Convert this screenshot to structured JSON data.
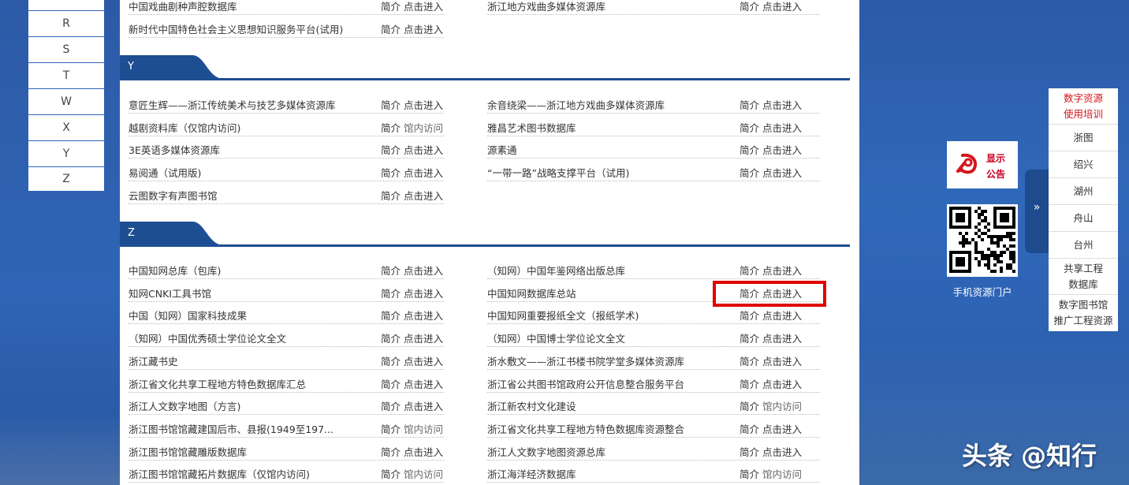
{
  "alphabet": {
    "partial": "",
    "letters": [
      "R",
      "S",
      "T",
      "W",
      "X",
      "Y",
      "Z"
    ]
  },
  "top_rows": [
    {
      "left": "中国戏曲剧种声腔数据库",
      "left_intro": "简介",
      "left_action": "点击进入",
      "right": "浙江地方戏曲多媒体资源库",
      "right_intro": "简介",
      "right_action": "点击进入"
    },
    {
      "left": "新时代中国特色社会主义思想知识服务平台(试用)",
      "left_intro": "简介",
      "left_action": "点击进入",
      "right": "",
      "right_intro": "",
      "right_action": ""
    }
  ],
  "section_y": {
    "label": "Y",
    "rows": [
      {
        "left": "意匠生辉——浙江传统美术与技艺多媒体资源库",
        "left_intro": "简介",
        "left_action": "点击进入",
        "right": "余音绕梁——浙江地方戏曲多媒体资源库",
        "right_intro": "简介",
        "right_action": "点击进入"
      },
      {
        "left": "越剧资料库（仅馆内访问)",
        "left_intro": "简介",
        "left_action": "馆内访问",
        "right": "雅昌艺术图书数据库",
        "right_intro": "简介",
        "right_action": "点击进入"
      },
      {
        "left": "3E英语多媒体资源库",
        "left_intro": "简介",
        "left_action": "点击进入",
        "right": "源素通",
        "right_intro": "简介",
        "right_action": "点击进入"
      },
      {
        "left": "易阅通（试用版)",
        "left_intro": "简介",
        "left_action": "点击进入",
        "right": "“一带一路”战略支撑平台（试用)",
        "right_intro": "简介",
        "right_action": "点击进入"
      },
      {
        "left": "云图数字有声图书馆",
        "left_intro": "简介",
        "left_action": "点击进入",
        "right": "",
        "right_intro": "",
        "right_action": ""
      }
    ]
  },
  "section_z": {
    "label": "Z",
    "rows": [
      {
        "left": "中国知网总库（包库)",
        "left_intro": "简介",
        "left_action": "点击进入",
        "right": "（知网）中国年鉴网络出版总库",
        "right_intro": "简介",
        "right_action": "点击进入"
      },
      {
        "left": "知网CNKI工具书馆",
        "left_intro": "简介",
        "left_action": "点击进入",
        "right": "中国知网数据库总站",
        "right_intro": "简介",
        "right_action": "点击进入"
      },
      {
        "left": "中国（知网）国家科技成果",
        "left_intro": "简介",
        "left_action": "点击进入",
        "right": "中国知网重要报纸全文（报纸学术)",
        "right_intro": "简介",
        "right_action": "点击进入"
      },
      {
        "left": "（知网）中国优秀硕士学位论文全文",
        "left_intro": "简介",
        "left_action": "点击进入",
        "right": "（知网）中国博士学位论文全文",
        "right_intro": "简介",
        "right_action": "点击进入"
      },
      {
        "left": "浙江藏书史",
        "left_intro": "简介",
        "left_action": "点击进入",
        "right": "浙水敷文——浙江书楼书院学堂多媒体资源库",
        "right_intro": "简介",
        "right_action": "点击进入"
      },
      {
        "left": "浙江省文化共享工程地方特色数据库汇总",
        "left_intro": "简介",
        "left_action": "点击进入",
        "right": "浙江省公共图书馆政府公开信息整合服务平台",
        "right_intro": "简介",
        "right_action": "点击进入"
      },
      {
        "left": "浙江人文数字地图（方言)",
        "left_intro": "简介",
        "left_action": "点击进入",
        "right": "浙江新农村文化建设",
        "right_intro": "简介",
        "right_action": "馆内访问"
      },
      {
        "left": "浙江图书馆馆藏建国后市、县报(1949至197...",
        "left_intro": "简介",
        "left_action": "馆内访问",
        "right": "浙江省文化共享工程地方特色数据库资源整合",
        "right_intro": "简介",
        "right_action": "点击进入"
      },
      {
        "left": "浙江图书馆馆藏雕版数据库",
        "left_intro": "简介",
        "left_action": "点击进入",
        "right": "浙江人文数字地图资源总库",
        "right_intro": "简介",
        "right_action": "点击进入"
      },
      {
        "left": "浙江图书馆馆藏拓片数据库（仅馆内访问)",
        "left_intro": "简介",
        "left_action": "馆内访问",
        "right": "浙江海洋经济数据库",
        "right_intro": "简介",
        "right_action": "馆内访问"
      }
    ]
  },
  "notice": {
    "line1": "显示",
    "line2": "公告",
    "icon": "party-emblem-icon"
  },
  "qr": {
    "label": "手机资源门户",
    "icon": "qr-code-icon"
  },
  "side_toggle": {
    "label": "»"
  },
  "side_menu": [
    {
      "label": "数字资源使用培训",
      "line1": "数字资源",
      "line2": "使用培训",
      "style": "red"
    },
    {
      "label": "浙图"
    },
    {
      "label": "绍兴"
    },
    {
      "label": "湖州"
    },
    {
      "label": "舟山"
    },
    {
      "label": "台州"
    },
    {
      "label": "共享工程数据库",
      "line1": "共享工程",
      "line2": "数据库"
    },
    {
      "label": "数字图书馆推广工程资源",
      "line1": "数字图书馆",
      "line2": "推广工程资源"
    }
  ],
  "watermark": "头条 @知行",
  "colors": {
    "accent": "#1e4e92",
    "highlight": "#e00000",
    "notice_red": "#c6001e"
  }
}
